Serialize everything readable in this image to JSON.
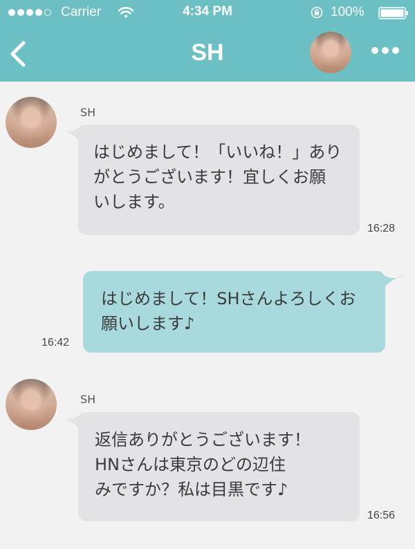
{
  "status_bar": {
    "carrier": "Carrier",
    "time": "4:34 PM",
    "battery": "100%"
  },
  "header": {
    "title": "SH",
    "back_icon": "chevron-left-icon",
    "more_icon": "more-horizontal-icon"
  },
  "colors": {
    "header": "#6cc0c4",
    "incoming_bubble": "#e3e3e5",
    "outgoing_bubble": "#a8dadd",
    "background": "#f2f2f2"
  },
  "messages": [
    {
      "direction": "incoming",
      "sender": "SH",
      "text": "はじめまして！「いいね！」あり\nがとうございます！宜しくお願\nいします。",
      "time": "16:28"
    },
    {
      "direction": "outgoing",
      "text": "はじめまして！SHさんよろしくお\n願いします♪",
      "time": "16:42"
    },
    {
      "direction": "incoming",
      "sender": "SH",
      "text": "返信ありがとうございます！\nHNさんは東京のどの辺住\nみですか？私は目黒です♪",
      "time": "16:56"
    }
  ]
}
